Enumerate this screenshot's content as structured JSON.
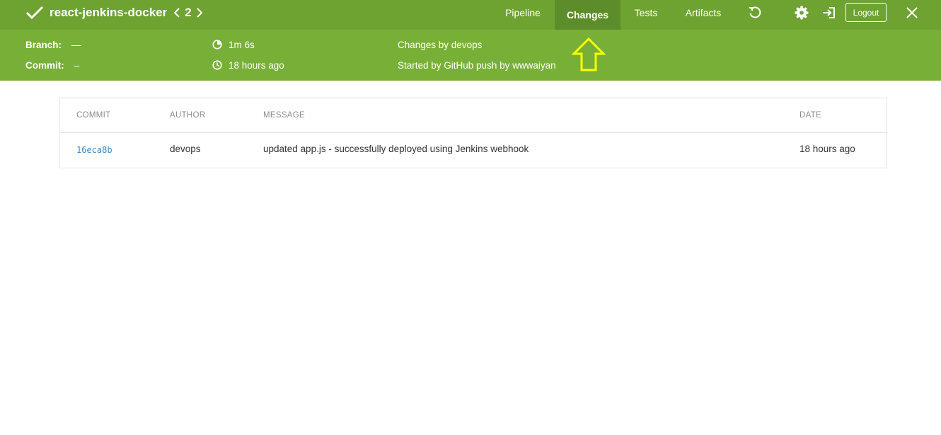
{
  "header": {
    "title": "react-jenkins-docker",
    "run_number": "2",
    "tabs": [
      {
        "label": "Pipeline",
        "active": false
      },
      {
        "label": "Changes",
        "active": true
      },
      {
        "label": "Tests",
        "active": false
      },
      {
        "label": "Artifacts",
        "active": false
      }
    ],
    "logout_label": "Logout",
    "icons": [
      "check-icon",
      "chevron-left-icon",
      "chevron-right-icon",
      "replay-icon",
      "gear-icon",
      "exit-icon",
      "close-icon"
    ]
  },
  "summary": {
    "branch_label": "Branch:",
    "branch_value": "—",
    "commit_label": "Commit:",
    "commit_value": "–",
    "duration": "1m 6s",
    "finished": "18 hours ago",
    "changes_by": "Changes by devops",
    "started_by": "Started by GitHub push by wwwaiyan"
  },
  "changes_table": {
    "columns": [
      "COMMIT",
      "AUTHOR",
      "MESSAGE",
      "DATE"
    ],
    "rows": [
      {
        "commit": "16eca8b",
        "author": "devops",
        "message": "updated app.js - successfully deployed using Jenkins webhook",
        "date": "18 hours ago"
      }
    ]
  },
  "colors": {
    "topbar": "#6ea332",
    "subbar": "#78b037",
    "active_tab": "#5d8c2a",
    "annotation_arrow": "#ffff00",
    "commit_link": "#3a86c8"
  }
}
